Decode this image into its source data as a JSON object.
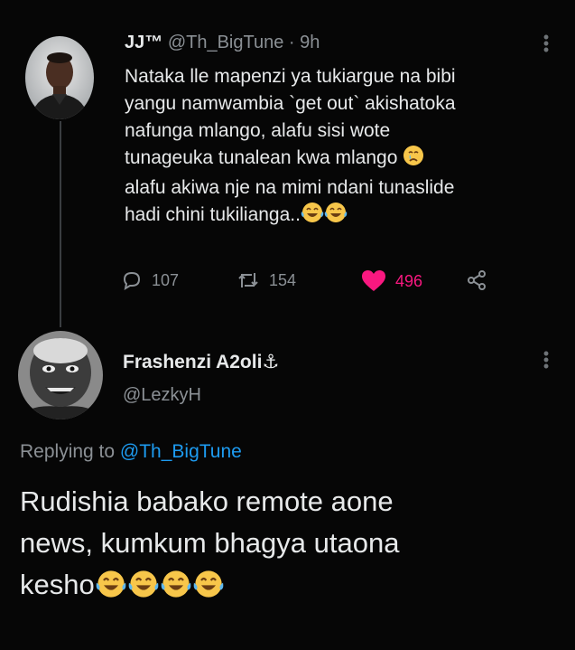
{
  "tweet1": {
    "display_name": "JJ™",
    "handle": "@Th_BigTune",
    "separator": "·",
    "time": "9h",
    "body_lines": [
      "Nataka lle mapenzi  ya tukiargue na bibi",
      "yangu namwambia `get out` akishatoka",
      "nafunga mlango, alafu sisi wote",
      "tunageuka tunalean kwa mlango",
      "alafu akiwa nje na mimi ndani tunaslide",
      "hadi chini tukilianga.."
    ],
    "emoji": {
      "line4": "crying-face",
      "line6": [
        "laughing-tears-face",
        "laughing-tears-face"
      ]
    },
    "stats": {
      "replies": "107",
      "retweets": "154",
      "likes": "496"
    },
    "like_color": "#f91880"
  },
  "tweet2": {
    "display_name": "Frashenzi A2oli",
    "name_badge": "⚓",
    "handle": "@LezkyH",
    "replying_prefix": "Replying to",
    "replying_handle": "@Th_BigTune",
    "body_lines": [
      "Rudishia babako remote aone",
      "news, kumkum bhagya utaona",
      "kesho"
    ],
    "emoji": {
      "line3": [
        "laughing-tears-face",
        "laughing-tears-face",
        "laughing-tears-face",
        "laughing-tears-face"
      ]
    },
    "link_color": "#1d9bf0"
  }
}
